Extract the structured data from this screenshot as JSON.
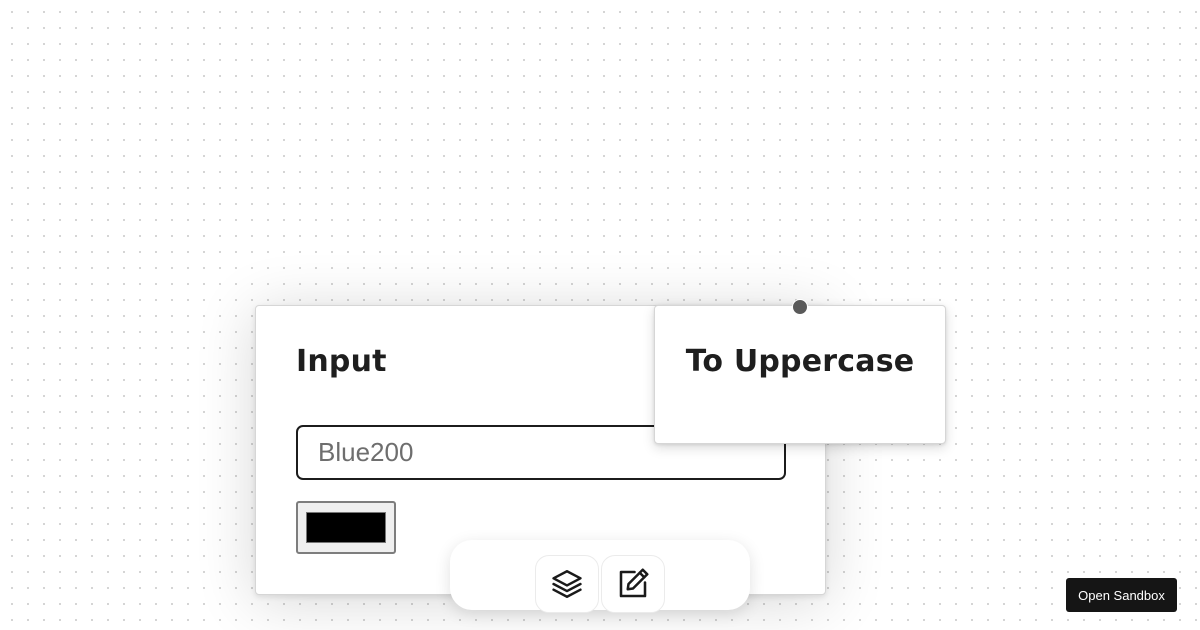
{
  "nodes": {
    "input": {
      "title": "Input",
      "text_value": "Blue200",
      "color_value": "#000000"
    },
    "to_uppercase": {
      "title": "To Uppercase"
    }
  },
  "toolbar": {
    "buttons": [
      {
        "icon": "layers-icon"
      },
      {
        "icon": "edit-icon"
      }
    ]
  },
  "sandbox_button": {
    "label": "Open Sandbox"
  }
}
